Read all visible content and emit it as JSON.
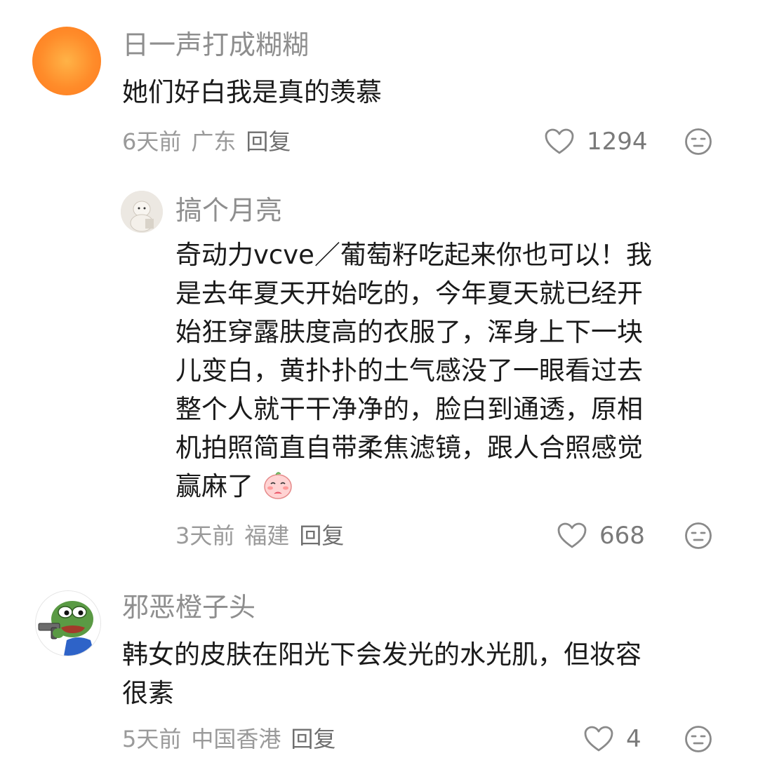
{
  "comments": [
    {
      "username": "日一声打成糊糊",
      "text": "她们好白我是真的羡慕",
      "time": "6天前",
      "location": "广东",
      "reply_label": "回复",
      "likes": "1294",
      "avatar_icon": "orange-gradient-avatar"
    },
    {
      "username": "搞个月亮",
      "lines": [
        "奇动力vcve／葡萄籽吃起来你也可以！我",
        "是去年夏天开始吃的，今年夏天就已经开",
        "始狂穿露肤度高的衣服了，浑身上下一块",
        "儿变白，黄扑扑的土气感没了一眼看过去",
        "整个人就干干净净的，脸白到通透，原相",
        "机拍照简直自带柔焦滤镜，跟人合照感觉",
        "赢麻了"
      ],
      "time": "3天前",
      "location": "福建",
      "reply_label": "回复",
      "likes": "668",
      "avatar_icon": "plush-toy-avatar",
      "inline_emoji": "blushing-peach-emoji"
    },
    {
      "username": "邪恶橙子头",
      "lines": [
        "韩女的皮肤在阳光下会发光的水光肌，但妆容",
        "很素"
      ],
      "time": "5天前",
      "location": "中国香港",
      "reply_label": "回复",
      "likes": "4",
      "avatar_icon": "frog-with-gun-avatar"
    }
  ],
  "colors": {
    "username": "#8e8e8e",
    "text": "#1a1a1a",
    "meta": "#9a9a9a",
    "icon_stroke": "#8a8a8a"
  }
}
